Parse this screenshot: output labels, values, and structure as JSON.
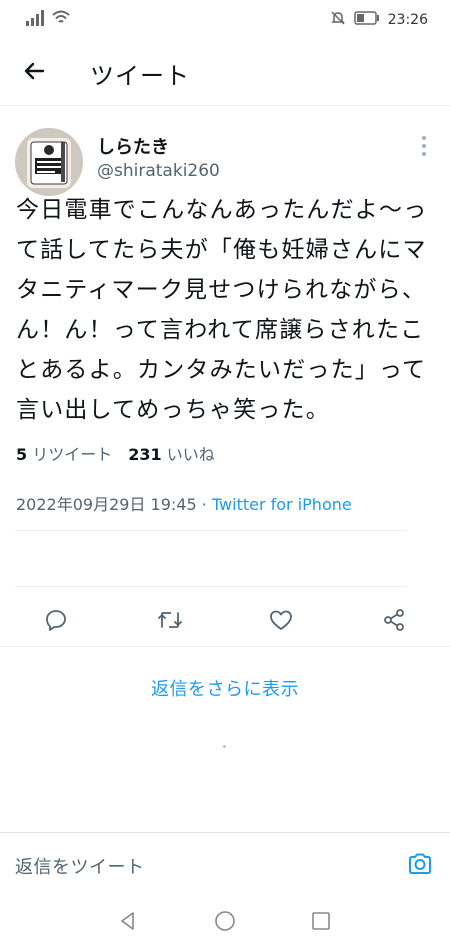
{
  "status_bar": {
    "time": "23:26",
    "icons": [
      "signal-icon",
      "wifi-icon",
      "mute-bell-icon",
      "battery-icon"
    ]
  },
  "app_bar": {
    "title": "ツイート",
    "back_icon": "arrow-left-icon"
  },
  "tweet": {
    "user_name": "しらたき",
    "user_handle": "@shirataki260",
    "avatar_label_lines": [
      "しらたき"
    ],
    "text": "今日電車でこんなんあったんだよ〜って話してたら夫が「俺も妊婦さんにマタニティマーク見せつけられながら、ん！ん！って言われて席譲らされたことあるよ。カンタみたいだった」って言い出してめっちゃ笑った。",
    "timestamp": "2022年09月29日 19:45",
    "separator": " · ",
    "source": "Twitter for iPhone",
    "retweet_count": "5",
    "retweet_label": "リツイート",
    "like_count": "231",
    "like_label": "いいね",
    "actions": [
      "reply-icon",
      "retweet-icon",
      "like-icon",
      "share-icon"
    ]
  },
  "more_replies_label": "返信をさらに表示",
  "reply_bar": {
    "placeholder": "返信をツイート",
    "camera_icon": "camera-icon"
  },
  "nav_bar": {
    "icons": [
      "back-triangle-icon",
      "home-circle-icon",
      "recents-square-icon"
    ]
  },
  "colors": {
    "accent": "#1d9bf0",
    "text_primary": "#0f1419",
    "text_secondary": "#536471",
    "divider": "#eceff1"
  }
}
